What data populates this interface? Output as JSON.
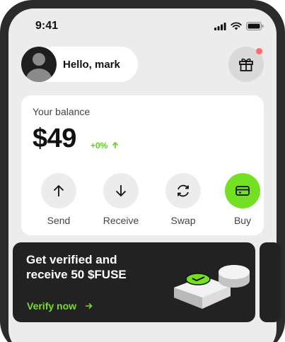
{
  "status_bar": {
    "time": "9:41"
  },
  "header": {
    "greeting": "Hello, mark"
  },
  "balance": {
    "label": "Your balance",
    "amount": "$49",
    "change": "+0%"
  },
  "actions": [
    {
      "label": "Send",
      "icon": "arrow-up-icon"
    },
    {
      "label": "Receive",
      "icon": "arrow-down-icon"
    },
    {
      "label": "Swap",
      "icon": "swap-icon"
    },
    {
      "label": "Buy",
      "icon": "card-icon"
    }
  ],
  "promo": {
    "title": "Get verified and receive 50 $FUSE",
    "cta": "Verify now"
  },
  "colors": {
    "accent": "#74e024",
    "notification_dot": "#ff6b6b",
    "promo_bg": "#222222"
  }
}
